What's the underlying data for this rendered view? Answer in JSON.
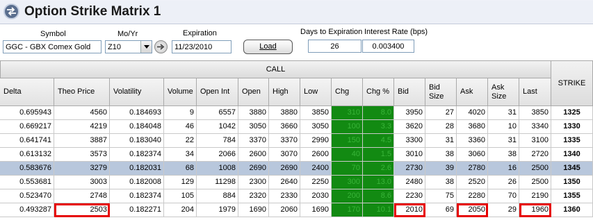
{
  "window": {
    "title": "Option Strike Matrix 1",
    "icon": "circle-arrow-icon"
  },
  "toolbar": {
    "symbol_label": "Symbol",
    "symbol_value": "GGC - GBX Comex Gold",
    "moyr_label": "Mo/Yr",
    "moyr_value": "Z10",
    "expiration_label": "Expiration",
    "expiration_value": "11/23/2010",
    "load_label": "Load",
    "days_label": "Days to Expiration",
    "days_value": "26",
    "rate_label": "Interest Rate (bps)",
    "rate_value": "0.003400"
  },
  "grid": {
    "group_header": "CALL",
    "strike_header": "STRIKE",
    "columns": [
      "Delta",
      "Theo Price",
      "Volatility",
      "Volume",
      "Open Int",
      "Open",
      "High",
      "Low",
      "Chg",
      "Chg %",
      "Bid",
      "Bid Size",
      "Ask",
      "Ask Size",
      "Last"
    ],
    "rows": [
      [
        "0.695943",
        "4560",
        "0.184693",
        "9",
        "6557",
        "3880",
        "3880",
        "3850",
        "310",
        "8.0",
        "3950",
        "27",
        "4020",
        "31",
        "3850",
        "1325"
      ],
      [
        "0.669217",
        "4219",
        "0.184048",
        "46",
        "1042",
        "3050",
        "3660",
        "3050",
        "100",
        "3.3",
        "3620",
        "28",
        "3680",
        "10",
        "3340",
        "1330"
      ],
      [
        "0.641741",
        "3887",
        "0.183040",
        "22",
        "784",
        "3370",
        "3370",
        "2990",
        "150",
        "4.5",
        "3300",
        "31",
        "3360",
        "31",
        "3100",
        "1335"
      ],
      [
        "0.613132",
        "3573",
        "0.182374",
        "34",
        "2066",
        "2600",
        "3070",
        "2600",
        "40",
        "1.5",
        "3010",
        "38",
        "3060",
        "38",
        "2720",
        "1340"
      ],
      [
        "0.583676",
        "3279",
        "0.182031",
        "68",
        "1008",
        "2690",
        "2690",
        "2400",
        "70",
        "2.6",
        "2730",
        "39",
        "2780",
        "16",
        "2500",
        "1345"
      ],
      [
        "0.553681",
        "3003",
        "0.182008",
        "129",
        "11298",
        "2300",
        "2640",
        "2250",
        "300",
        "13.0",
        "2480",
        "38",
        "2520",
        "26",
        "2500",
        "1350"
      ],
      [
        "0.523470",
        "2748",
        "0.182374",
        "105",
        "884",
        "2320",
        "2330",
        "2030",
        "200",
        "8.6",
        "2230",
        "75",
        "2280",
        "70",
        "2190",
        "1355"
      ],
      [
        "0.493287",
        "2503",
        "0.182271",
        "204",
        "1979",
        "1690",
        "2060",
        "1690",
        "170",
        "10.1",
        "2010",
        "69",
        "2050",
        "29",
        "1960",
        "1360"
      ]
    ],
    "selected_row": 4,
    "highlighted_cells": [
      [
        7,
        1
      ],
      [
        7,
        10
      ],
      [
        7,
        12
      ],
      [
        7,
        14
      ]
    ]
  },
  "colors": {
    "chg_bg": "#128a12",
    "chg_text": "#39b539",
    "selected_row": "#b8c7dc",
    "highlight": "#e60000"
  }
}
